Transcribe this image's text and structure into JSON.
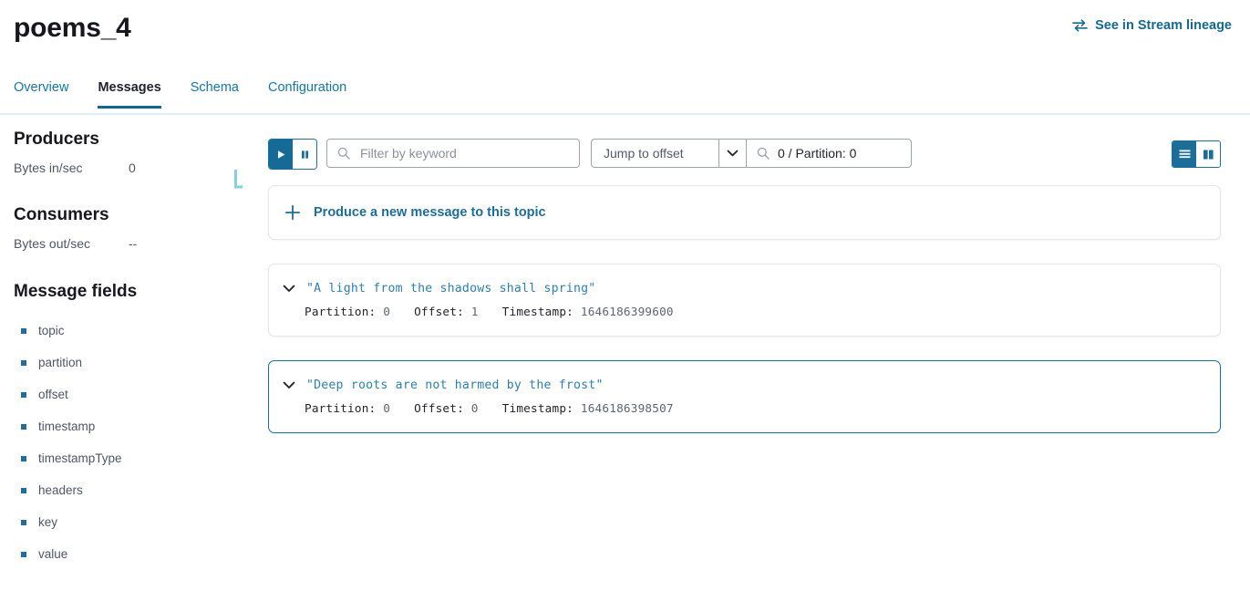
{
  "header": {
    "title": "poems_4",
    "lineage_link_label": "See in Stream lineage",
    "lineage_icon": "compare-arrows-icon"
  },
  "tabs": [
    {
      "label": "Overview",
      "active": false
    },
    {
      "label": "Messages",
      "active": true
    },
    {
      "label": "Schema",
      "active": false
    },
    {
      "label": "Configuration",
      "active": false
    }
  ],
  "sidebar": {
    "producers": {
      "heading": "Producers",
      "metric_label": "Bytes in/sec",
      "metric_value": "0"
    },
    "consumers": {
      "heading": "Consumers",
      "metric_label": "Bytes out/sec",
      "metric_value": "--"
    },
    "message_fields": {
      "heading": "Message fields",
      "items": [
        "topic",
        "partition",
        "offset",
        "timestamp",
        "timestampType",
        "headers",
        "key",
        "value"
      ]
    }
  },
  "toolbar": {
    "play_icon": "play-icon",
    "pause_icon": "pause-icon",
    "play_active": true,
    "filter": {
      "icon": "search-icon",
      "placeholder": "Filter by keyword",
      "value": ""
    },
    "offset": {
      "select_label": "Jump to offset",
      "caret_icon": "chevron-down-icon",
      "search_icon": "search-icon",
      "search_value": "0 / Partition: 0"
    },
    "view_toggle": {
      "list_icon": "list-view-icon",
      "card_icon": "card-view-icon",
      "active": "list"
    }
  },
  "produce_card": {
    "icon": "plus-icon",
    "label": "Produce a new message to this topic"
  },
  "messages": [
    {
      "chevron_icon": "chevron-down-icon",
      "text": "\"A light from the shadows shall spring\"",
      "partition_label": "Partition:",
      "partition_value": "0",
      "offset_label": "Offset:",
      "offset_value": "1",
      "timestamp_label": "Timestamp:",
      "timestamp_value": "1646186399600",
      "selected": false
    },
    {
      "chevron_icon": "chevron-down-icon",
      "text": "\"Deep roots are not harmed by the frost\"",
      "partition_label": "Partition:",
      "partition_value": "0",
      "offset_label": "Offset:",
      "offset_value": "0",
      "timestamp_label": "Timestamp:",
      "timestamp_value": "1646186398507",
      "selected": true
    }
  ],
  "colors": {
    "accent": "#136a93",
    "link": "#1476a8",
    "tab_underline": "#0b6a8f",
    "tab_baseline": "#dbeefa",
    "monotext": "#2d7fb0",
    "sparkline": "#7fd3de"
  }
}
